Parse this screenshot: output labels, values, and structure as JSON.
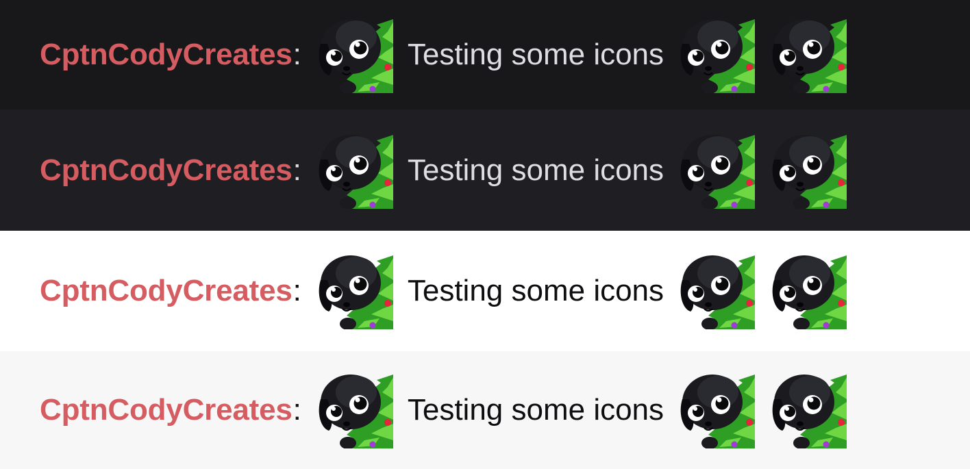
{
  "colors": {
    "username": "#d55c60",
    "tree_green": "#35b52c",
    "tree_light": "#7be04b",
    "ornament_red": "#e8233a",
    "ornament_purple": "#a13ad6"
  },
  "emote": {
    "icon": "puppy-christmas-tree-emote"
  },
  "rows": [
    {
      "theme": "dark",
      "background": "#18181b",
      "text_color": "#dedee3",
      "username": "CptnCodyCreates",
      "colon": ":",
      "message": "Testing some icons"
    },
    {
      "theme": "dark-alt",
      "background": "#1f1f23",
      "text_color": "#dedee3",
      "username": "CptnCodyCreates",
      "colon": ":",
      "message": "Testing some icons"
    },
    {
      "theme": "light",
      "background": "#ffffff",
      "text_color": "#0e0e10",
      "username": "CptnCodyCreates",
      "colon": ":",
      "message": "Testing some icons"
    },
    {
      "theme": "light-alt",
      "background": "#f7f7f8",
      "text_color": "#0e0e10",
      "username": "CptnCodyCreates",
      "colon": ":",
      "message": "Testing some icons"
    }
  ]
}
